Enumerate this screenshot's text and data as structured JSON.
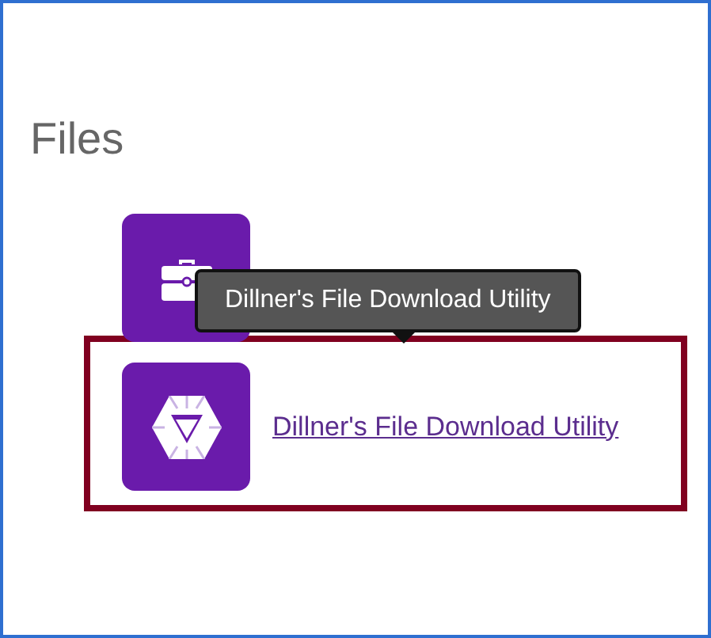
{
  "heading": "Files",
  "files": [
    {
      "kind": "briefcase",
      "highlighted": false
    },
    {
      "kind": "gem",
      "label": "Dillner's File Download Utility",
      "highlighted": true
    }
  ],
  "tooltip": {
    "text": "Dillner's File Download Utility"
  }
}
